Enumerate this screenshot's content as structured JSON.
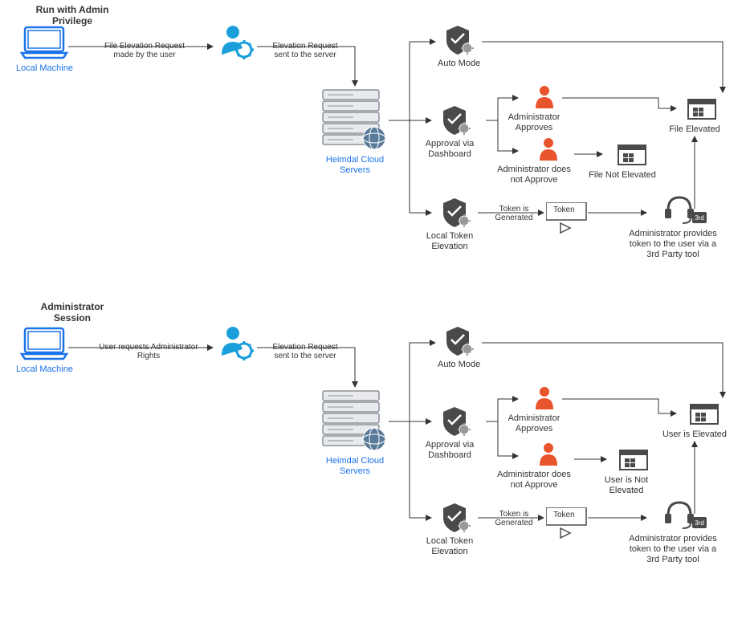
{
  "diagram1": {
    "title": "Run with Admin Privilege",
    "localMachine": "Local Machine",
    "edge1": "File Elevation Request made by the user",
    "edge2": "Elevation Request sent to the server",
    "cloudServers": "Heimdal Cloud Servers",
    "autoMode": "Auto Mode",
    "approvalDashboard": "Approval via Dashboard",
    "localTokenElevation": "Local Token Elevation",
    "adminApproves": "Administrator Approves",
    "adminNotApprove": "Administrator does not Approve",
    "fileNotElevated": "File Not Elevated",
    "fileElevated": "File Elevated",
    "tokenGenerated": "Token is Generated",
    "token": "Token",
    "adminProvidesToken": "Administrator provides token to the user via a 3rd Party tool"
  },
  "diagram2": {
    "title": "Administrator Session",
    "localMachine": "Local Machine",
    "edge1": "User requests Administrator Rights",
    "edge2": "Elevation Request sent to the server",
    "cloudServers": "Heimdal Cloud Servers",
    "autoMode": "Auto Mode",
    "approvalDashboard": "Approval via Dashboard",
    "localTokenElevation": "Local Token Elevation",
    "adminApproves": "Administrator Approves",
    "adminNotApprove": "Administrator does not Approve",
    "userNotElevated": "User is Not Elevated",
    "userElevated": "User is Elevated",
    "tokenGenerated": "Token is Generated",
    "token": "Token",
    "adminProvidesToken": "Administrator provides token to the user via a 3rd Party tool"
  }
}
